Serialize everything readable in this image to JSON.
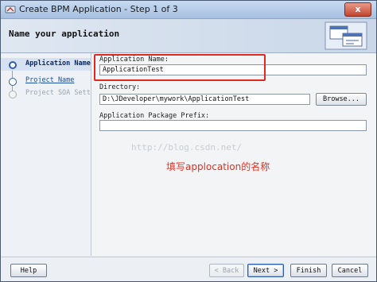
{
  "window": {
    "title": "Create BPM Application - Step 1 of 3",
    "close_label": "x",
    "app_icon": "bpm-app-icon"
  },
  "header": {
    "title": "Name your application",
    "graphic_icon": "wizard-graphic-icon"
  },
  "steps": [
    {
      "label": "Application Name",
      "state": "active"
    },
    {
      "label": "Project Name",
      "state": "link"
    },
    {
      "label": "Project SOA Settings",
      "state": "disabled"
    }
  ],
  "form": {
    "app_name_label": "Application Name:",
    "app_name_value": "ApplicationTest",
    "directory_label": "Directory:",
    "directory_value": "D:\\JDeveloper\\mywork\\ApplicationTest",
    "browse_label": "Browse...",
    "package_label": "Application Package Prefix:",
    "package_value": ""
  },
  "overlay": {
    "watermark": "http://blog.csdn.net/",
    "annotation": "填写applocation的名称",
    "highlight_color": "#e02a20"
  },
  "footer": {
    "help": "Help",
    "back": "< Back",
    "next": "Next >",
    "finish": "Finish",
    "cancel": "Cancel"
  }
}
